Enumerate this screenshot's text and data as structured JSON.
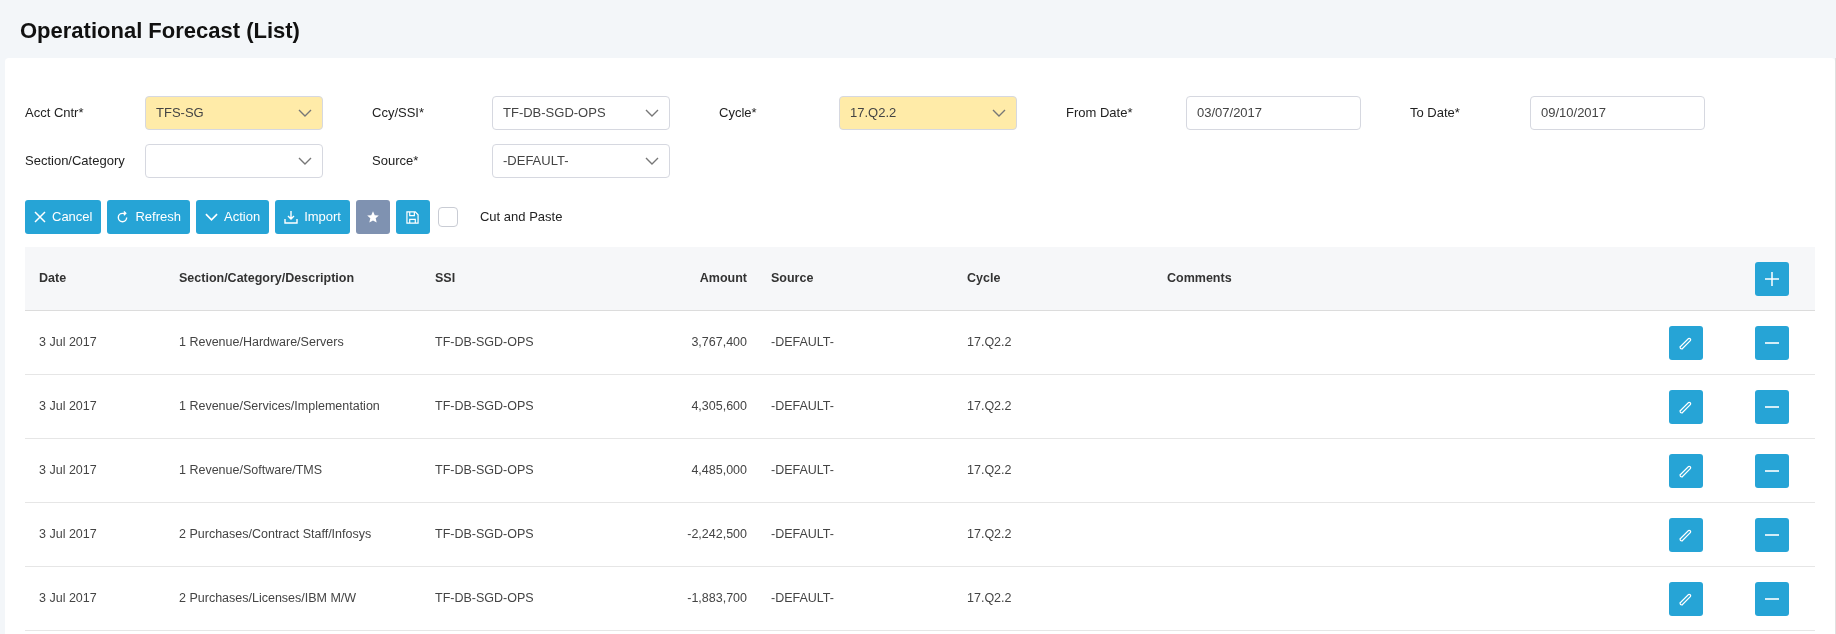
{
  "page": {
    "title": "Operational Forecast (List)"
  },
  "filters": [
    {
      "label": "Acct Cntr*",
      "kind": "select",
      "value": "TFS-SG",
      "highlighted": true
    },
    {
      "label": "Ccy/SSI*",
      "kind": "select",
      "value": "TF-DB-SGD-OPS",
      "highlighted": false
    },
    {
      "label": "Cycle*",
      "kind": "select",
      "value": "17.Q2.2",
      "highlighted": true
    },
    {
      "label": "From Date*",
      "kind": "date",
      "value": "03/07/2017",
      "highlighted": false
    },
    {
      "label": "To Date*",
      "kind": "date",
      "value": "09/10/2017",
      "highlighted": false
    },
    {
      "label": "Section/Category",
      "kind": "select",
      "highlighted": false
    },
    {
      "label": "Source*",
      "kind": "select",
      "value": "-DEFAULT-",
      "highlighted": false
    }
  ],
  "toolbar": [
    {
      "kind": "cancel",
      "label": "Cancel"
    },
    {
      "kind": "refresh",
      "label": "Refresh"
    },
    {
      "kind": "action",
      "label": "Action"
    },
    {
      "kind": "import",
      "label": "Import"
    },
    {
      "kind": "favorite"
    },
    {
      "kind": "save"
    }
  ],
  "cut_and_paste": {
    "label": "Cut and Paste",
    "checked": false
  },
  "table": {
    "columns": [
      "Date",
      "Section/Category/Description",
      "SSI",
      "Amount",
      "Source",
      "Cycle",
      "Comments"
    ],
    "rows": [
      {
        "cells": [
          "3 Jul 2017",
          "1 Revenue/Hardware/Servers",
          "TF-DB-SGD-OPS",
          "3,767,400",
          "-DEFAULT-",
          "17.Q2.2"
        ]
      },
      {
        "cells": [
          "3 Jul 2017",
          "1 Revenue/Services/Implementation",
          "TF-DB-SGD-OPS",
          "4,305,600",
          "-DEFAULT-",
          "17.Q2.2"
        ]
      },
      {
        "cells": [
          "3 Jul 2017",
          "1 Revenue/Software/TMS",
          "TF-DB-SGD-OPS",
          "4,485,000",
          "-DEFAULT-",
          "17.Q2.2"
        ]
      },
      {
        "cells": [
          "3 Jul 2017",
          "2 Purchases/Contract Staff/Infosys",
          "TF-DB-SGD-OPS",
          "-2,242,500",
          "-DEFAULT-",
          "17.Q2.2"
        ]
      },
      {
        "cells": [
          "3 Jul 2017",
          "2 Purchases/Licenses/IBM M/W",
          "TF-DB-SGD-OPS",
          "-1,883,700",
          "-DEFAULT-",
          "17.Q2.2"
        ]
      }
    ]
  }
}
